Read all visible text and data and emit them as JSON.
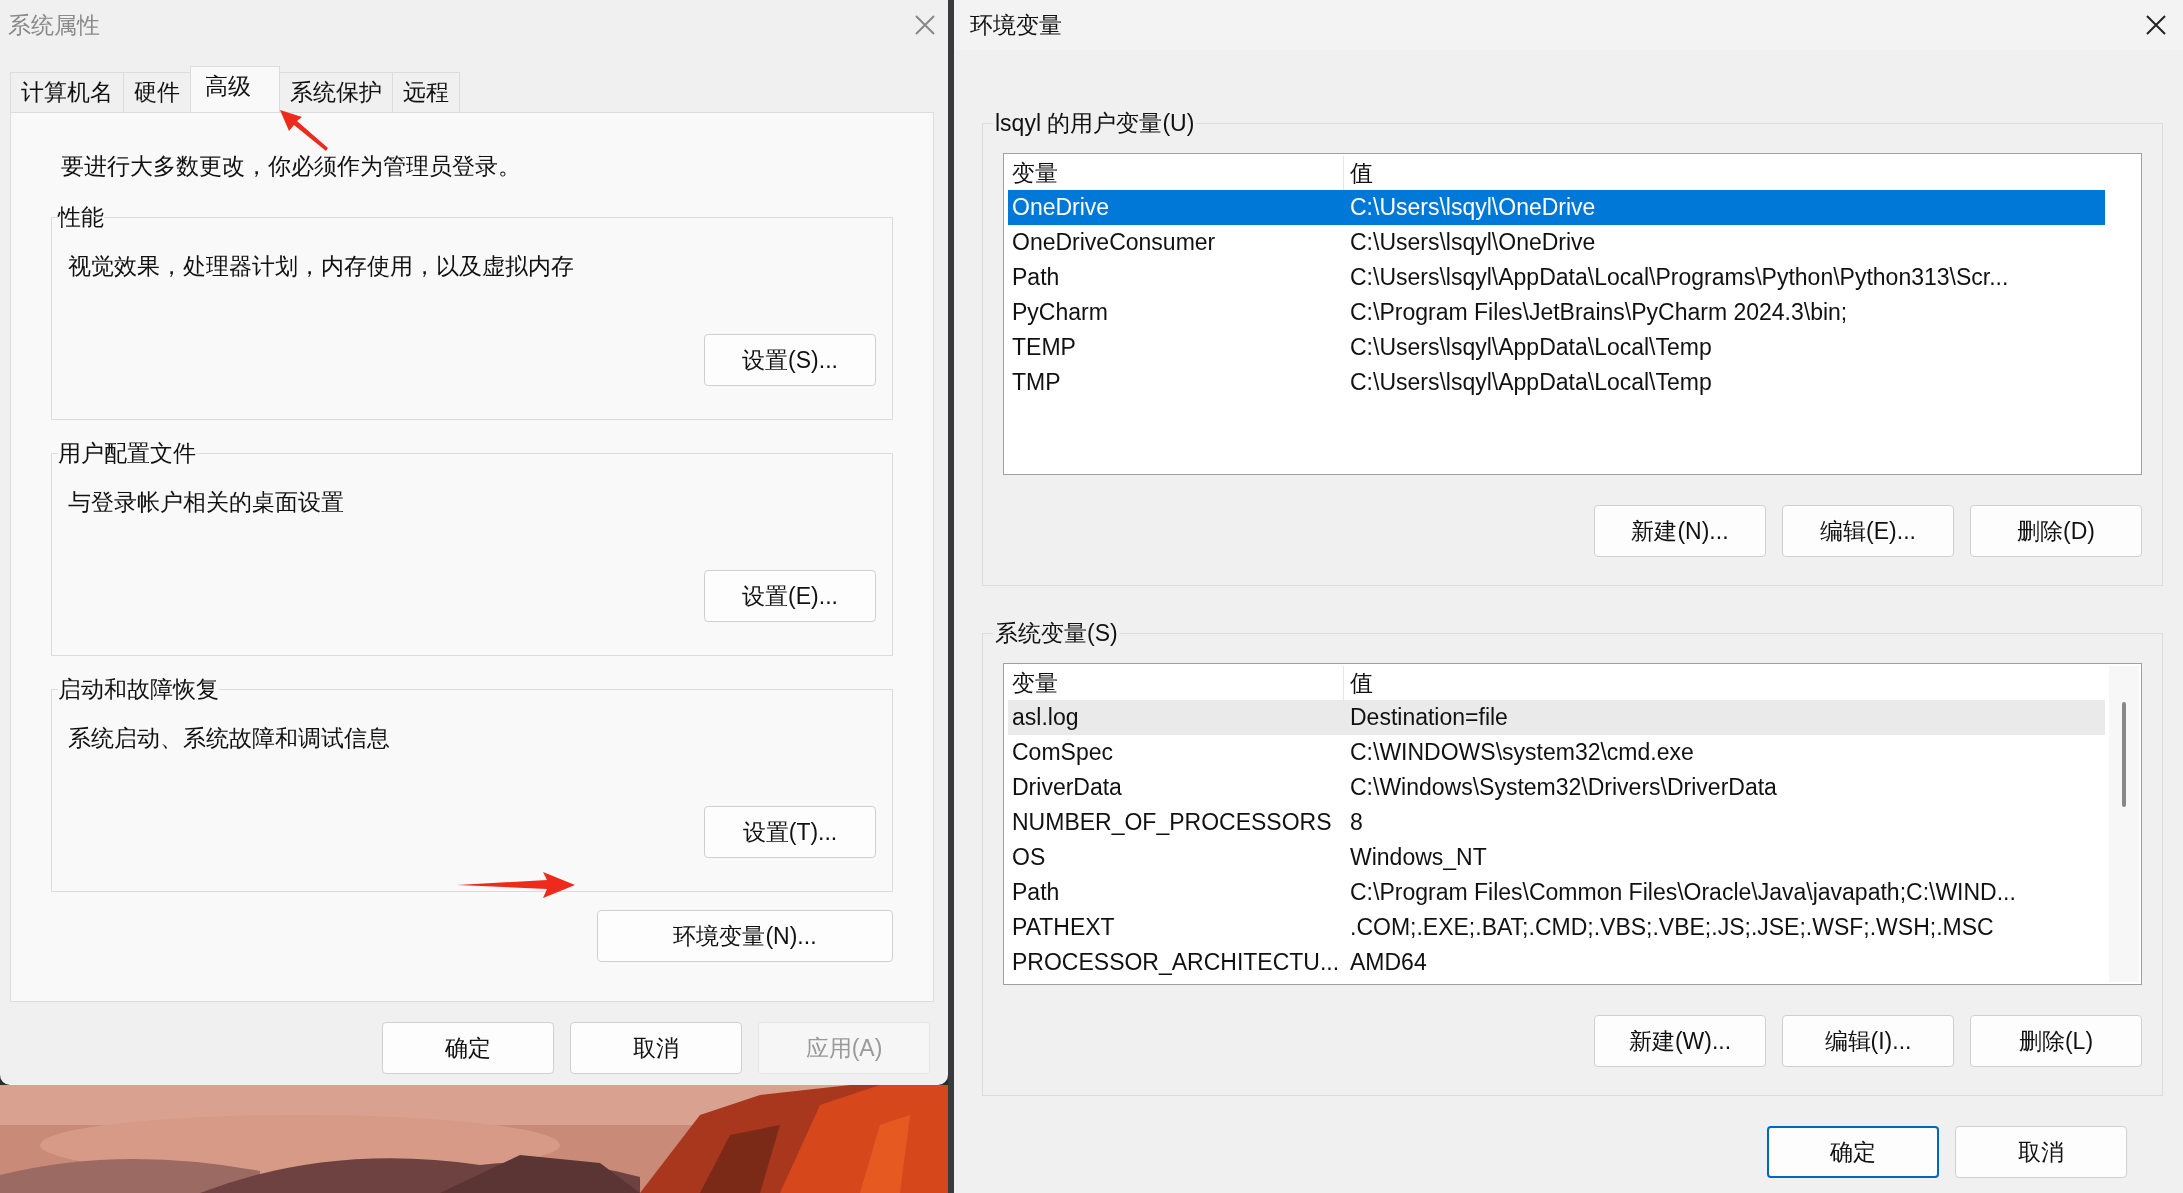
{
  "system_properties": {
    "title": "系统属性",
    "tabs": [
      {
        "label": "计算机名",
        "selected": false
      },
      {
        "label": "硬件",
        "selected": false
      },
      {
        "label": "高级",
        "selected": true
      },
      {
        "label": "系统保护",
        "selected": false
      },
      {
        "label": "远程",
        "selected": false
      }
    ],
    "notice": "要进行大多数更改，你必须作为管理员登录。",
    "groups": [
      {
        "title": "性能",
        "description": "视觉效果，处理器计划，内存使用，以及虚拟内存",
        "button": "设置(S)..."
      },
      {
        "title": "用户配置文件",
        "description": "与登录帐户相关的桌面设置",
        "button": "设置(E)..."
      },
      {
        "title": "启动和故障恢复",
        "description": "系统启动、系统故障和调试信息",
        "button": "设置(T)..."
      }
    ],
    "env_button": "环境变量(N)...",
    "buttons": [
      {
        "label": "确定",
        "disabled": false
      },
      {
        "label": "取消",
        "disabled": false
      },
      {
        "label": "应用(A)",
        "disabled": true
      }
    ]
  },
  "environment_variables": {
    "title": "环境变量",
    "sections": [
      {
        "title": "lsqyl 的用户变量(U)",
        "focused": true,
        "columns": [
          "变量",
          "值"
        ],
        "rows": [
          {
            "name": "OneDrive",
            "value": "C:\\Users\\lsqyl\\OneDrive",
            "selected": true
          },
          {
            "name": "OneDriveConsumer",
            "value": "C:\\Users\\lsqyl\\OneDrive",
            "selected": false
          },
          {
            "name": "Path",
            "value": "C:\\Users\\lsqyl\\AppData\\Local\\Programs\\Python\\Python313\\Scr...",
            "selected": false
          },
          {
            "name": "PyCharm",
            "value": "C:\\Program Files\\JetBrains\\PyCharm 2024.3\\bin;",
            "selected": false
          },
          {
            "name": "TEMP",
            "value": "C:\\Users\\lsqyl\\AppData\\Local\\Temp",
            "selected": false
          },
          {
            "name": "TMP",
            "value": "C:\\Users\\lsqyl\\AppData\\Local\\Temp",
            "selected": false
          }
        ],
        "buttons": [
          "新建(N)...",
          "编辑(E)...",
          "删除(D)"
        ]
      },
      {
        "title": "系统变量(S)",
        "focused": false,
        "columns": [
          "变量",
          "值"
        ],
        "rows": [
          {
            "name": "asl.log",
            "value": "Destination=file",
            "selected": true
          },
          {
            "name": "ComSpec",
            "value": "C:\\WINDOWS\\system32\\cmd.exe",
            "selected": false
          },
          {
            "name": "DriverData",
            "value": "C:\\Windows\\System32\\Drivers\\DriverData",
            "selected": false
          },
          {
            "name": "NUMBER_OF_PROCESSORS",
            "value": "8",
            "selected": false
          },
          {
            "name": "OS",
            "value": "Windows_NT",
            "selected": false
          },
          {
            "name": "Path",
            "value": "C:\\Program Files\\Common Files\\Oracle\\Java\\javapath;C:\\WIND...",
            "selected": false
          },
          {
            "name": "PATHEXT",
            "value": ".COM;.EXE;.BAT;.CMD;.VBS;.VBE;.JS;.JSE;.WSF;.WSH;.MSC",
            "selected": false
          },
          {
            "name": "PROCESSOR_ARCHITECTU...",
            "value": "AMD64",
            "selected": false
          }
        ],
        "buttons": [
          "新建(W)...",
          "编辑(I)...",
          "删除(L)"
        ]
      }
    ],
    "buttons": [
      {
        "label": "确定",
        "default": true
      },
      {
        "label": "取消",
        "default": false
      }
    ]
  }
}
